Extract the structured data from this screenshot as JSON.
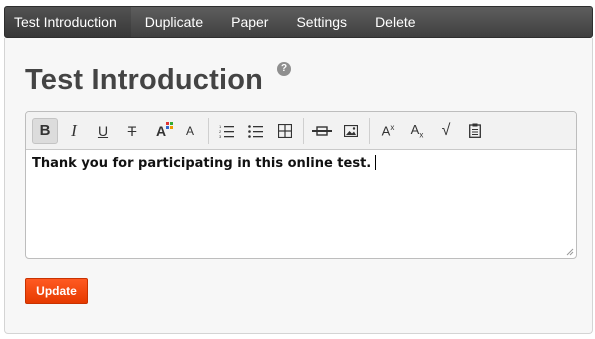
{
  "nav": {
    "items": [
      {
        "label": "Test Introduction"
      },
      {
        "label": "Duplicate"
      },
      {
        "label": "Paper"
      },
      {
        "label": "Settings"
      },
      {
        "label": "Delete"
      }
    ]
  },
  "page": {
    "title": "Test Introduction",
    "help_icon": "?"
  },
  "toolbar": {
    "buttons": [
      {
        "icon": "bold-icon",
        "glyph": "B"
      },
      {
        "icon": "italic-icon",
        "glyph": "I"
      },
      {
        "icon": "underline-icon",
        "glyph": "U"
      },
      {
        "icon": "strikethrough-icon",
        "glyph": "T"
      },
      {
        "icon": "font-color-icon",
        "glyph": "A"
      },
      {
        "icon": "font-size-icon",
        "glyph": "A"
      },
      {
        "icon": "ordered-list-icon"
      },
      {
        "icon": "unordered-list-icon"
      },
      {
        "icon": "table-icon"
      },
      {
        "icon": "horizontal-rule-icon"
      },
      {
        "icon": "image-icon"
      },
      {
        "icon": "superscript-icon",
        "glyph": "A",
        "sub": "x"
      },
      {
        "icon": "subscript-icon",
        "glyph": "A",
        "sub": "x"
      },
      {
        "icon": "math-icon",
        "glyph": "√"
      },
      {
        "icon": "paste-icon"
      }
    ]
  },
  "editor": {
    "content": "Thank you for participating in this online test."
  },
  "actions": {
    "update_label": "Update"
  },
  "colors": {
    "accent": "#ff4a12",
    "nav_bg": "#4f4f4f"
  }
}
